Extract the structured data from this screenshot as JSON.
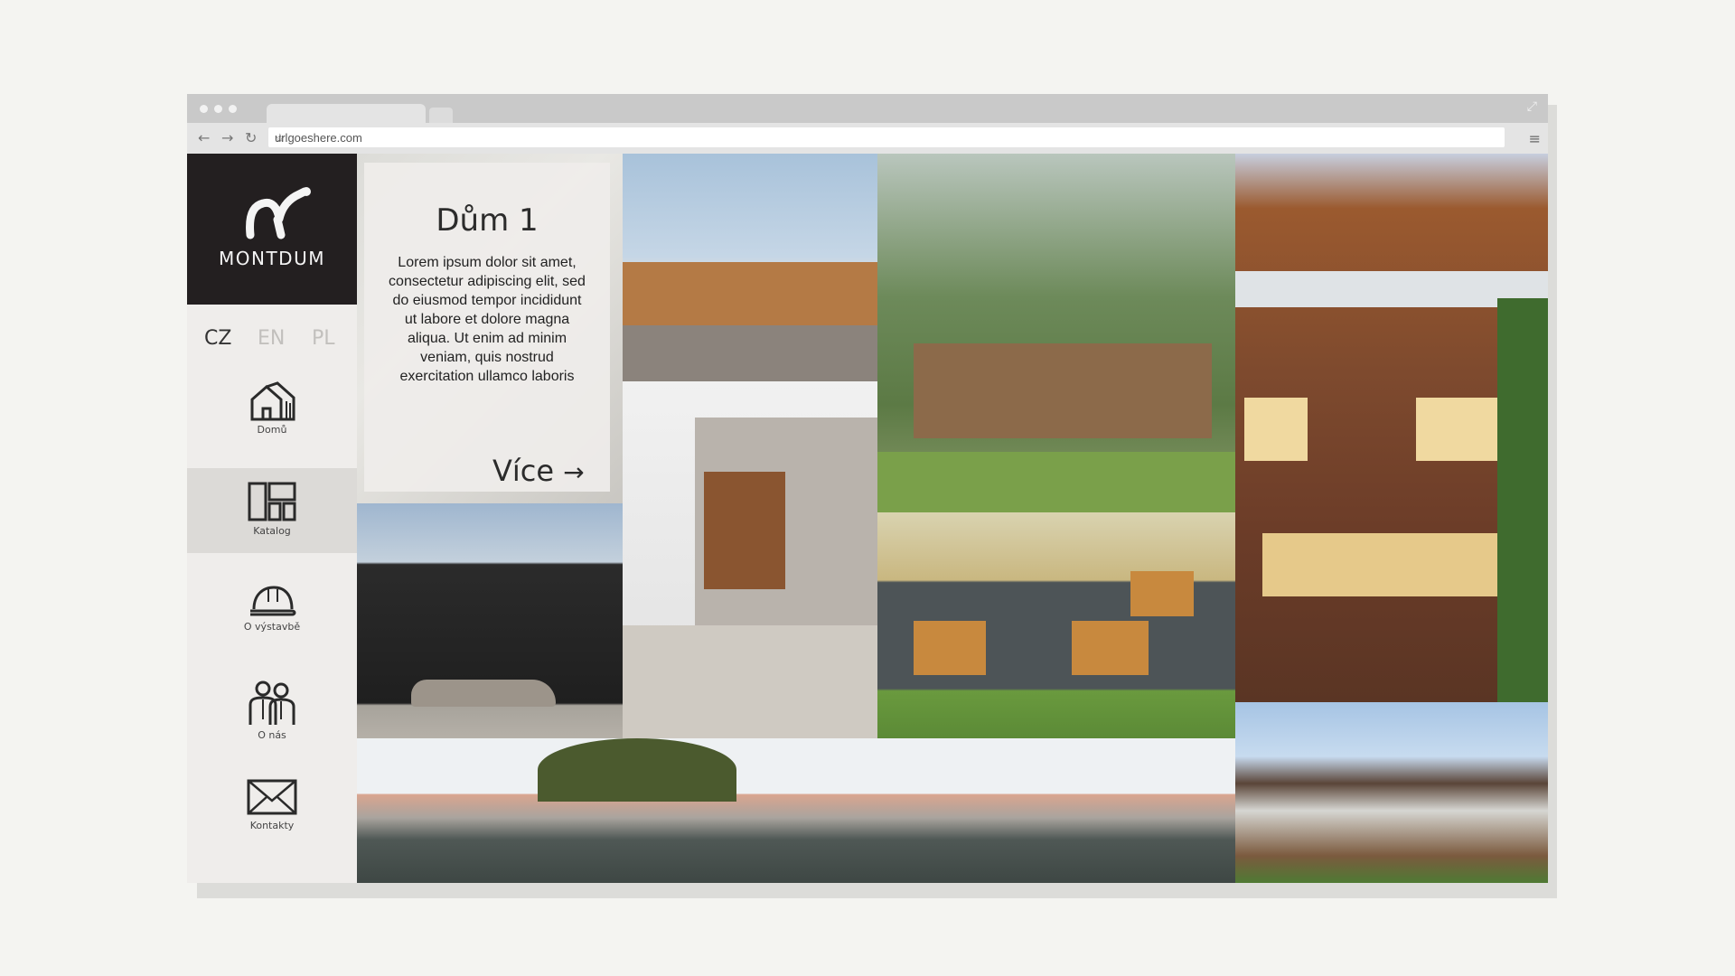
{
  "browser": {
    "url": "urlgoeshere.com",
    "nav": {
      "back": "←",
      "forward": "→",
      "reload": "↻"
    },
    "star": "☆",
    "menu": "≡",
    "expand": "⤢"
  },
  "sidebar": {
    "logo_text": "MONTDUM",
    "languages": [
      {
        "code": "CZ",
        "active": true
      },
      {
        "code": "EN",
        "active": false
      },
      {
        "code": "PL",
        "active": false
      }
    ],
    "items": [
      {
        "label": "Domů",
        "icon": "houses-icon"
      },
      {
        "label": "Katalog",
        "icon": "layout-grid-icon",
        "active": true
      },
      {
        "label": "O výstavbě",
        "icon": "hard-hat-icon"
      },
      {
        "label": "O nás",
        "icon": "people-icon"
      },
      {
        "label": "Kontakty",
        "icon": "envelope-icon"
      }
    ]
  },
  "card": {
    "title": "Dům 1",
    "text": "Lorem ipsum dolor sit amet, consectetur adipiscing elit, sed do eiusmod tempor incididunt ut labore et dolore magna aliqua. Ut enim ad minim veniam, quis nostrud exercitation ullamco laboris",
    "more": "Více",
    "more_arrow": "→"
  },
  "colors": {
    "page_bg": "#f4f4f1",
    "logo_bg": "#231f20",
    "sidebar_bg": "#efedeb",
    "active_item_bg": "#dcdad7",
    "lang_active": "#333333",
    "lang_inactive": "#c2c0bd"
  }
}
